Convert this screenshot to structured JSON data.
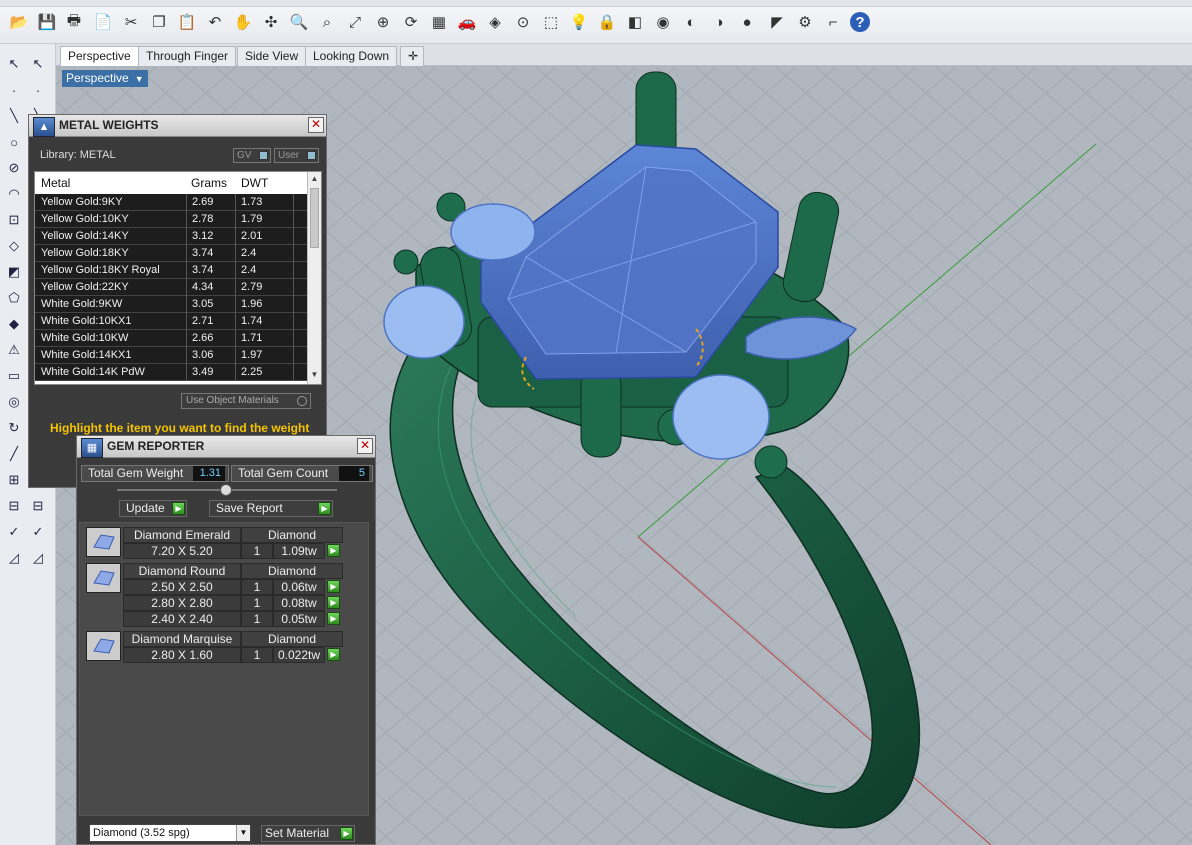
{
  "toolbar": {
    "icons": [
      "open-icon",
      "save-icon",
      "print-icon",
      "new-icon",
      "cut-icon",
      "copy-icon",
      "paste-icon",
      "undo-icon",
      "pan-icon",
      "rotate-icon",
      "zoom-icon",
      "zoom-window-icon",
      "zoom-extents-icon",
      "zoom-selected-icon",
      "rotate-view-icon",
      "grid-icon",
      "car-icon",
      "shape-icon",
      "snap-icon",
      "transform-icon",
      "light-icon",
      "lock-icon",
      "material-icon",
      "color-icon",
      "render-sphere-icon",
      "render-sphere2-icon",
      "render-blue-icon",
      "select-icon",
      "settings-icon",
      "bracket-icon",
      "help-icon"
    ]
  },
  "tabs": [
    "Perspective",
    "Through Finger",
    "Side View",
    "Looking Down"
  ],
  "viewport": {
    "label": "Perspective"
  },
  "metal_weights": {
    "title": "METAL WEIGHTS",
    "library": "Library: METAL",
    "gv_label": "GV",
    "user_label": "User",
    "headers": [
      "Metal",
      "Grams",
      "DWT"
    ],
    "rows": [
      [
        "Yellow Gold:9KY",
        "2.69",
        "1.73"
      ],
      [
        "Yellow Gold:10KY",
        "2.78",
        "1.79"
      ],
      [
        "Yellow Gold:14KY",
        "3.12",
        "2.01"
      ],
      [
        "Yellow Gold:18KY",
        "3.74",
        "2.4"
      ],
      [
        "Yellow Gold:18KY Royal",
        "3.74",
        "2.4"
      ],
      [
        "Yellow Gold:22KY",
        "4.34",
        "2.79"
      ],
      [
        "White Gold:9KW",
        "3.05",
        "1.96"
      ],
      [
        "White Gold:10KX1",
        "2.71",
        "1.74"
      ],
      [
        "White Gold:10KW",
        "2.66",
        "1.71"
      ],
      [
        "White Gold:14KX1",
        "3.06",
        "1.97"
      ],
      [
        "White Gold:14K PdW",
        "3.49",
        "2.25"
      ]
    ],
    "use_object_materials": "Use Object Materials",
    "hint": "Highlight the item you want to find the weight"
  },
  "gem_reporter": {
    "title": "GEM REPORTER",
    "total_weight_label": "Total Gem Weight",
    "total_weight": "1.31",
    "total_count_label": "Total Gem Count",
    "total_count": "5",
    "update_label": "Update",
    "save_report_label": "Save Report",
    "groups": [
      {
        "name": "Diamond Emerald",
        "material": "Diamond",
        "lines": [
          [
            "7.20 X 5.20",
            "1",
            "1.09tw"
          ]
        ]
      },
      {
        "name": "Diamond Round",
        "material": "Diamond",
        "lines": [
          [
            "2.50 X 2.50",
            "1",
            "0.06tw"
          ],
          [
            "2.80 X 2.80",
            "1",
            "0.08tw"
          ],
          [
            "2.40 X 2.40",
            "1",
            "0.05tw"
          ]
        ]
      },
      {
        "name": "Diamond Marquise",
        "material": "Diamond",
        "lines": [
          [
            "2.80 X 1.60",
            "1",
            "0.022tw"
          ]
        ]
      }
    ],
    "material_select": "Diamond    (3.52 spg)",
    "set_material_label": "Set Material"
  }
}
